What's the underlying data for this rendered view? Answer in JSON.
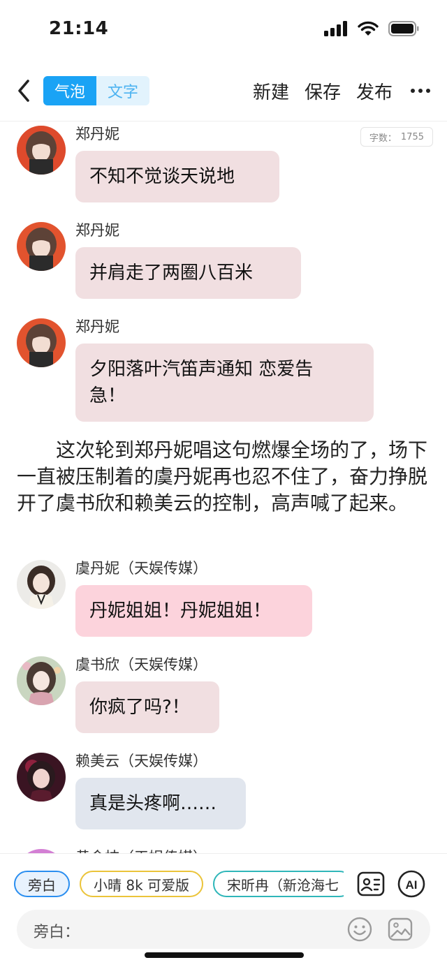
{
  "status": {
    "time": "21:14"
  },
  "nav": {
    "seg_bubble": "气泡",
    "seg_text": "文字",
    "new_label": "新建",
    "save_label": "保存",
    "publish_label": "发布"
  },
  "wordcount": {
    "label": "字数：",
    "value": "1755"
  },
  "messages": [
    {
      "name": "郑丹妮",
      "lines": [
        "不知不觉谈天说地"
      ]
    },
    {
      "name": "郑丹妮",
      "lines": [
        "并肩走了两圈八百米"
      ]
    },
    {
      "name": "郑丹妮",
      "lines": [
        "夕阳落叶汽笛声通知 恋爱告",
        "急！"
      ]
    },
    {
      "name": "虞丹妮（天娱传媒）",
      "lines": [
        "丹妮姐姐！丹妮姐姐！"
      ]
    },
    {
      "name": "虞书欣（天娱传媒）",
      "lines": [
        "你疯了吗?！"
      ]
    },
    {
      "name": "赖美云（天娱传媒）",
      "lines": [
        "真是头疼啊……"
      ]
    }
  ],
  "narration": "这次轮到郑丹妮唱这句燃爆全场的了，场下一直被压制着的虞丹妮再也忍不住了，奋力挣脱开了虞书欣和赖美云的控制，高声喊了起来。",
  "partial_name": "黄金桔（天娱传媒）",
  "chips": [
    "旁白",
    "小晴 8k 可爱版",
    "宋昕冉（新沧海七"
  ],
  "input": {
    "label": "旁白："
  },
  "colors": {
    "accent": "#1aa3f5",
    "bubble_gray": "#f1dfe1",
    "bubble_pink": "#fcd3dc",
    "bubble_blue": "#e1e6ee"
  }
}
